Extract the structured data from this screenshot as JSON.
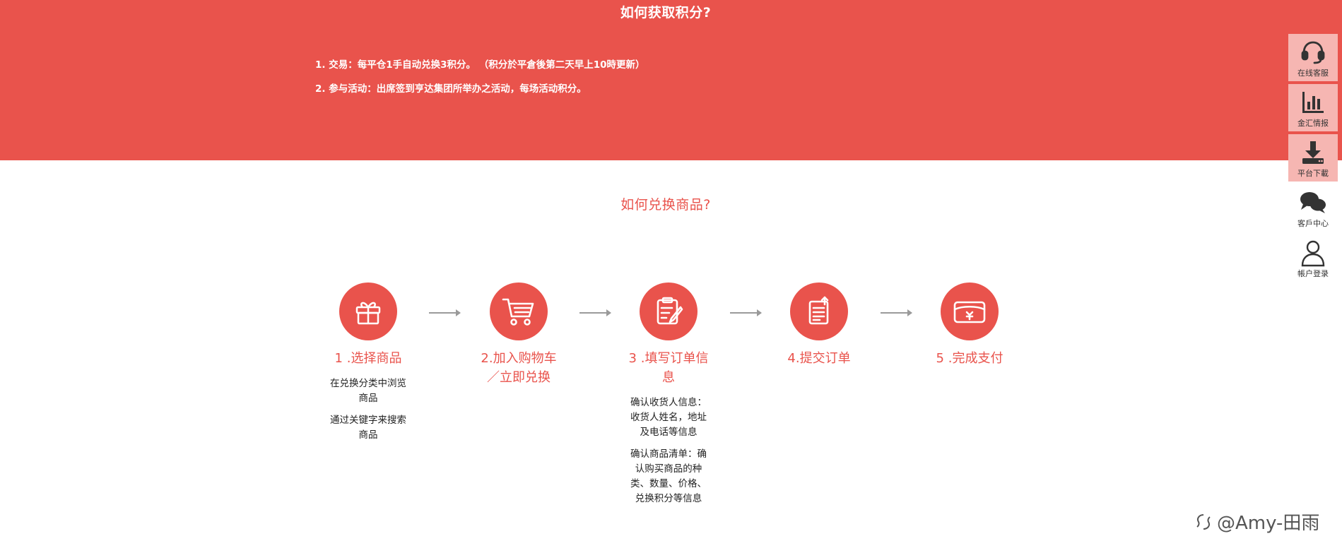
{
  "earn": {
    "title": "如何获取积分?",
    "rules": [
      "1. 交易：每平仓1手自动兑换3积分。 （积分於平倉後第二天早上10時更新）",
      "2. 参与活动：出席签到亨达集团所举办之活动，每场活动积分。"
    ]
  },
  "redeem": {
    "title": "如何兑换商品?",
    "steps": [
      {
        "label": "1 .选择商品",
        "icon": "gift-icon",
        "desc": [
          "在兑换分类中浏览商品",
          "通过关键字来搜索商品"
        ]
      },
      {
        "label": "2.加入购物车／立即兑换",
        "icon": "cart-icon",
        "desc": []
      },
      {
        "label": "3 .填写订单信息",
        "icon": "order-form-icon",
        "desc": [
          "确认收货人信息：收货人姓名，地址及电话等信息",
          "确认商品清单：确认购买商品的种类、数量、价格、兑换积分等信息"
        ]
      },
      {
        "label": "4.提交订单",
        "icon": "submit-order-icon",
        "desc": []
      },
      {
        "label": "5 .完成支付",
        "icon": "payment-card-icon",
        "desc": []
      }
    ]
  },
  "sidebar": {
    "items": [
      {
        "label": "在线客服",
        "icon": "headset-icon"
      },
      {
        "label": "金汇情报",
        "icon": "bar-chart-icon"
      },
      {
        "label": "平台下載",
        "icon": "download-icon"
      },
      {
        "label": "客戶中心",
        "icon": "chat-bubbles-icon"
      },
      {
        "label": "帳户登录",
        "icon": "user-icon"
      }
    ]
  },
  "watermark": {
    "text": "@Amy-田雨"
  },
  "colors": {
    "brand_red": "#e9534c",
    "sidebar_pink": "#f6b6b2"
  }
}
